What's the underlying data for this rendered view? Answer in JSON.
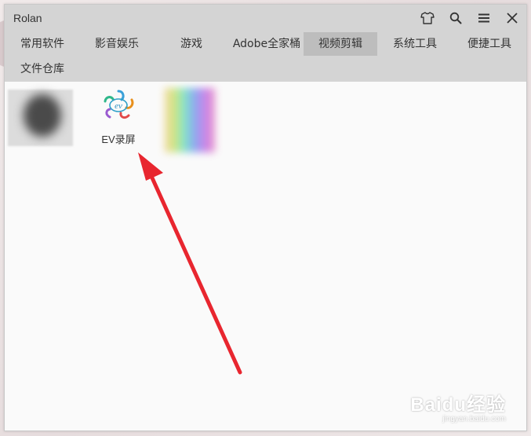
{
  "window": {
    "title": "Rolan"
  },
  "titlebar_icons": [
    {
      "name": "shirt-icon"
    },
    {
      "name": "search-icon"
    },
    {
      "name": "menu-icon"
    },
    {
      "name": "close-icon"
    }
  ],
  "tabs": [
    {
      "label": "常用软件",
      "active": false
    },
    {
      "label": "影音娱乐",
      "active": false
    },
    {
      "label": "游戏",
      "active": false
    },
    {
      "label": "Adobe全家桶",
      "active": false
    },
    {
      "label": "视频剪辑",
      "active": true
    },
    {
      "label": "系统工具",
      "active": false
    },
    {
      "label": "便捷工具",
      "active": false
    },
    {
      "label": "文件仓库",
      "active": false
    }
  ],
  "apps": [
    {
      "label": "",
      "icon": "blurred-app-icon"
    },
    {
      "label": "EV录屏",
      "icon": "ev-recorder-icon"
    },
    {
      "label": "",
      "icon": "blurred-app-icon"
    }
  ],
  "annotation": {
    "arrow_color": "#e8262f"
  },
  "watermark": {
    "main": "Baidu经验",
    "sub": "jingyan.baidu.com"
  },
  "colors": {
    "titlebar_bg": "#d4d4d4",
    "active_tab_bg": "#bdbdbd",
    "content_bg": "#fafafa"
  }
}
